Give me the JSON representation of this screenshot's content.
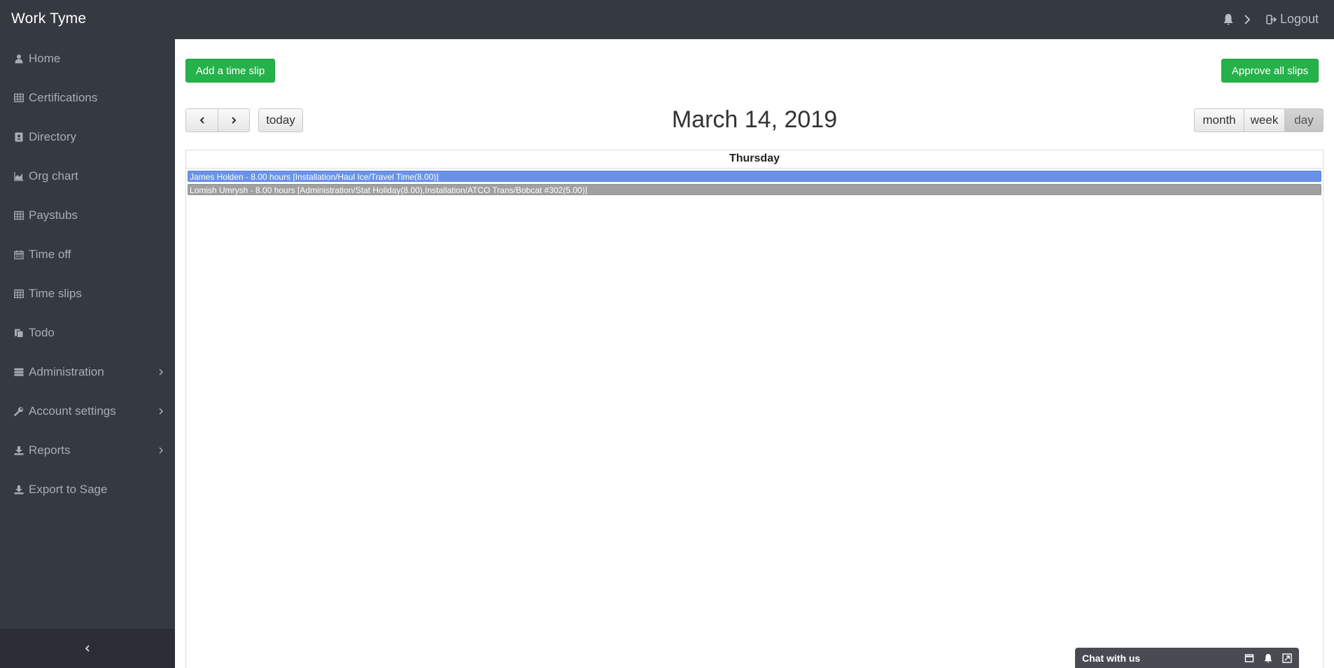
{
  "app": {
    "title": "Work Tyme"
  },
  "header": {
    "logout_label": "Logout"
  },
  "sidebar": {
    "items": [
      {
        "label": "Home",
        "icon": "user-icon"
      },
      {
        "label": "Certifications",
        "icon": "table-icon"
      },
      {
        "label": "Directory",
        "icon": "address-book-icon"
      },
      {
        "label": "Org chart",
        "icon": "area-chart-icon"
      },
      {
        "label": "Paystubs",
        "icon": "table-icon"
      },
      {
        "label": "Time off",
        "icon": "calendar-icon"
      },
      {
        "label": "Time slips",
        "icon": "table-icon"
      },
      {
        "label": "Todo",
        "icon": "clipboard-icon"
      },
      {
        "label": "Administration",
        "icon": "server-icon",
        "has_submenu": true
      },
      {
        "label": "Account settings",
        "icon": "wrench-icon",
        "has_submenu": true
      },
      {
        "label": "Reports",
        "icon": "download-icon",
        "has_submenu": true
      },
      {
        "label": "Export to Sage",
        "icon": "download-icon"
      }
    ]
  },
  "toolbar": {
    "add_label": "Add a time slip",
    "approve_label": "Approve all slips",
    "today_label": "today",
    "view_month": "month",
    "view_week": "week",
    "view_day": "day",
    "active_view": "day"
  },
  "calendar": {
    "title": "March 14, 2019",
    "day_header": "Thursday",
    "events": [
      {
        "text": "James Holden - 8.00 hours [Installation/Haul Ice/Travel Time(8.00)]",
        "color": "#6a93e8"
      },
      {
        "text": "Lomish Umrysh - 8.00 hours [Administration/Stat Holiday(8.00),Installation/ATCO Trans/Bobcat #302(5.00)]",
        "color": "#a0a0a0"
      }
    ]
  },
  "chat": {
    "label": "Chat with us"
  },
  "colors": {
    "accent_green": "#26b24a",
    "sidebar_bg": "#353a41"
  }
}
